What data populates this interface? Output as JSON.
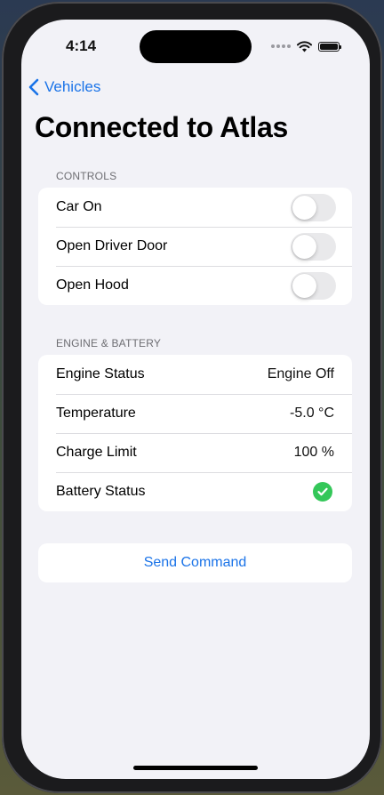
{
  "status_bar": {
    "time": "4:14"
  },
  "nav": {
    "back_label": "Vehicles"
  },
  "title": "Connected to Atlas",
  "controls": {
    "header": "CONTROLS",
    "items": [
      {
        "label": "Car On",
        "on": false
      },
      {
        "label": "Open Driver Door",
        "on": false
      },
      {
        "label": "Open Hood",
        "on": false
      }
    ]
  },
  "engine_battery": {
    "header": "ENGINE & BATTERY",
    "engine_status": {
      "label": "Engine Status",
      "value": "Engine Off"
    },
    "temperature": {
      "label": "Temperature",
      "value": "-5.0 °C"
    },
    "charge_limit": {
      "label": "Charge Limit",
      "value": "100 %"
    },
    "battery_status": {
      "label": "Battery Status",
      "icon": "checkmark-circle-icon"
    }
  },
  "send_button": {
    "label": "Send Command"
  },
  "colors": {
    "accent": "#1a73e8",
    "success": "#34c759",
    "background": "#f2f2f7"
  }
}
